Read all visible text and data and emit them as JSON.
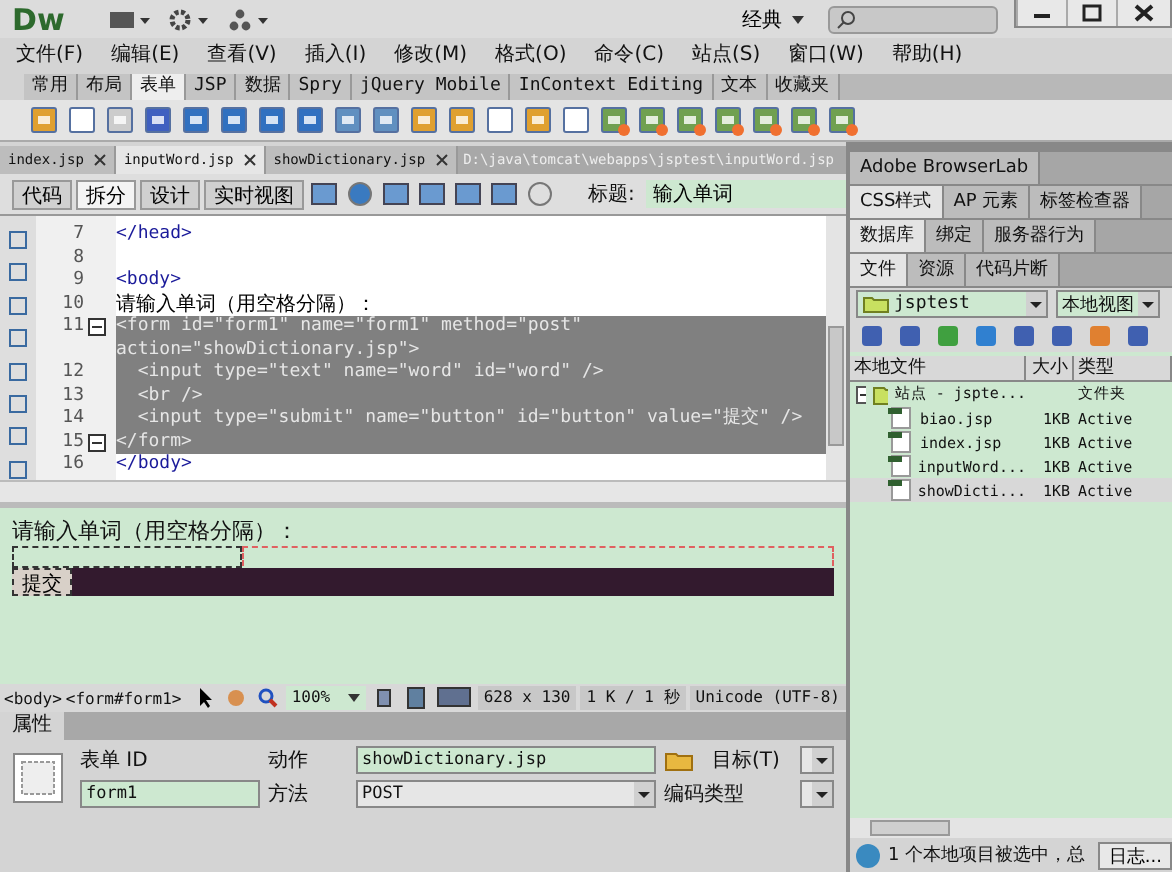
{
  "app": {
    "logo": "Dw",
    "workspace": "经典"
  },
  "menu": [
    "文件(F)",
    "编辑(E)",
    "查看(V)",
    "插入(I)",
    "修改(M)",
    "格式(O)",
    "命令(C)",
    "站点(S)",
    "窗口(W)",
    "帮助(H)"
  ],
  "insert_tabs": [
    {
      "label": "常用",
      "selected": false
    },
    {
      "label": "布局",
      "selected": false
    },
    {
      "label": "表单",
      "selected": true
    },
    {
      "label": "JSP",
      "selected": false
    },
    {
      "label": "数据",
      "selected": false
    },
    {
      "label": "Spry",
      "selected": false
    },
    {
      "label": "jQuery Mobile",
      "selected": false
    },
    {
      "label": "InContext Editing",
      "selected": false
    },
    {
      "label": "文本",
      "selected": false
    },
    {
      "label": "收藏夹",
      "selected": false
    }
  ],
  "doc_tabs": [
    {
      "label": "index.jsp",
      "selected": false
    },
    {
      "label": "inputWord.jsp",
      "selected": true
    },
    {
      "label": "showDictionary.jsp",
      "selected": false
    }
  ],
  "doc_path": "D:\\java\\tomcat\\webapps\\jsptest\\inputWord.jsp",
  "view_buttons": [
    {
      "label": "代码",
      "selected": false
    },
    {
      "label": "拆分",
      "selected": true
    },
    {
      "label": "设计",
      "selected": false
    },
    {
      "label": "实时视图",
      "selected": false
    }
  ],
  "page_title": {
    "label": "标题:",
    "value": "输入单词"
  },
  "code_lines": [
    {
      "number": "7",
      "text": "</head>",
      "kind": "tag",
      "selected": false,
      "fold": false
    },
    {
      "number": "8",
      "selected": false,
      "fold": false
    },
    {
      "number": "9",
      "text": "<body>",
      "kind": "tag",
      "selected": false,
      "fold": false
    },
    {
      "number": "10",
      "text": "请输入单词（用空格分隔）：",
      "kind": "text",
      "selected": false,
      "fold": false
    },
    {
      "number": "11",
      "text": "<form id=\"form1\" name=\"form1\" method=\"post\" action=\"showDictionary.jsp\">",
      "kind": "tag",
      "selected": true,
      "fold": true
    },
    {
      "number": "12",
      "text": "  <input type=\"text\" name=\"word\" id=\"word\" />",
      "kind": "tag",
      "selected": true,
      "fold": false
    },
    {
      "number": "13",
      "text": "  <br />",
      "kind": "tag",
      "selected": true,
      "fold": false
    },
    {
      "number": "14",
      "text": "  <input type=\"submit\" name=\"button\" id=\"button\" value=\"提交\" />",
      "kind": "tag",
      "selected": true,
      "fold": false
    },
    {
      "number": "15",
      "text": "</form>",
      "kind": "tag",
      "selected": true,
      "fold": true
    },
    {
      "number": "16",
      "text": "</body>",
      "kind": "tag",
      "selected": false,
      "fold": false
    }
  ],
  "design": {
    "prompt": "请输入单词（用空格分隔）：",
    "button": "提交"
  },
  "status_bar": {
    "tags": [
      "<body>",
      "<form#form1>"
    ],
    "zoom": "100%",
    "size": "628 x 130",
    "download": "1 K / 1 秒",
    "encoding": "Unicode (UTF-8)"
  },
  "properties": {
    "title": "属性",
    "form_id_label": "表单 ID",
    "form_id": "form1",
    "action_label": "动作",
    "action": "showDictionary.jsp",
    "target_label": "目标(T)",
    "method_label": "方法",
    "method": "POST",
    "enctype_label": "编码类型"
  },
  "panel_groups": [
    [
      {
        "label": "Adobe BrowserLab",
        "selected": false
      }
    ],
    [
      {
        "label": "CSS样式",
        "selected": true
      },
      {
        "label": "AP 元素",
        "selected": false
      },
      {
        "label": "标签检查器",
        "selected": false
      }
    ],
    [
      {
        "label": "数据库",
        "selected": true
      },
      {
        "label": "绑定",
        "selected": false
      },
      {
        "label": "服务器行为",
        "selected": false
      }
    ],
    [
      {
        "label": "文件",
        "selected": true
      },
      {
        "label": "资源",
        "selected": false
      },
      {
        "label": "代码片断",
        "selected": false
      }
    ]
  ],
  "files": {
    "site": "jsptest",
    "view": "本地视图",
    "columns": [
      "本地文件",
      "大小",
      "类型"
    ],
    "tree": {
      "name": "站点 - jspte...",
      "type": "文件夹",
      "expanded": true,
      "children": [
        {
          "name": "biao.jsp",
          "size": "1KB",
          "type": "Active",
          "selected": false
        },
        {
          "name": "index.jsp",
          "size": "1KB",
          "type": "Active",
          "selected": false
        },
        {
          "name": "inputWord...",
          "size": "1KB",
          "type": "Active",
          "selected": false
        },
        {
          "name": "showDicti...",
          "size": "1KB",
          "type": "Active",
          "selected": true
        }
      ]
    },
    "status": "1 个本地项目被选中，总",
    "log_button": "日志..."
  }
}
